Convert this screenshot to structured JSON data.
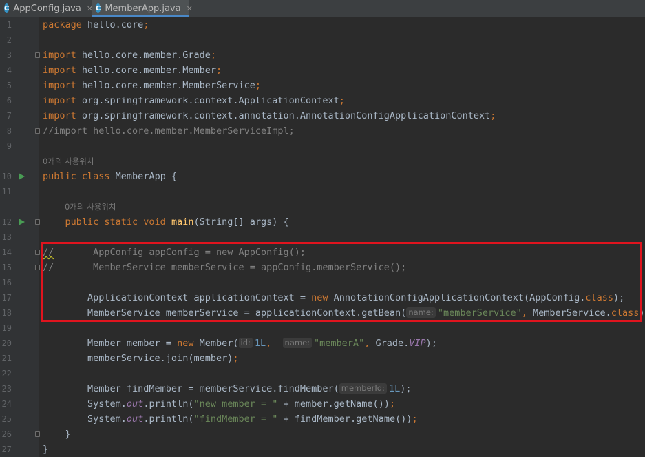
{
  "tabs": [
    {
      "icon": "C",
      "label": "AppConfig.java",
      "close": "✕"
    },
    {
      "icon": "C",
      "label": "MemberApp.java",
      "close": "✕"
    }
  ],
  "lines": [
    {
      "n": "1",
      "segs": [
        [
          "kw",
          "package "
        ],
        [
          "",
          "hello.core"
        ],
        [
          "kw",
          ";"
        ]
      ]
    },
    {
      "n": "2",
      "segs": []
    },
    {
      "n": "3",
      "segs": [
        [
          "kw",
          "import "
        ],
        [
          "",
          "hello.core.member.Grade"
        ],
        [
          "kw",
          ";"
        ]
      ]
    },
    {
      "n": "4",
      "segs": [
        [
          "kw",
          "import "
        ],
        [
          "",
          "hello.core.member.Member"
        ],
        [
          "kw",
          ";"
        ]
      ]
    },
    {
      "n": "5",
      "segs": [
        [
          "kw",
          "import "
        ],
        [
          "",
          "hello.core.member.MemberService"
        ],
        [
          "kw",
          ";"
        ]
      ]
    },
    {
      "n": "6",
      "segs": [
        [
          "kw",
          "import "
        ],
        [
          "",
          "org.springframework.context.ApplicationContext"
        ],
        [
          "kw",
          ";"
        ]
      ]
    },
    {
      "n": "7",
      "segs": [
        [
          "kw",
          "import "
        ],
        [
          "",
          "org.springframework.context.annotation.AnnotationConfigApplicationContext"
        ],
        [
          "kw",
          ";"
        ]
      ]
    },
    {
      "n": "8",
      "segs": [
        [
          "cm",
          "//import hello.core.member.MemberServiceImpl;"
        ]
      ]
    },
    {
      "n": "9",
      "segs": []
    },
    {
      "hint": "0개의 사용위치",
      "indent": 0
    },
    {
      "n": "10",
      "segs": [
        [
          "kw",
          "public class "
        ],
        [
          "",
          "MemberApp {"
        ]
      ]
    },
    {
      "n": "11",
      "segs": []
    },
    {
      "hint": "0개의 사용위치",
      "indent": 4
    },
    {
      "n": "12",
      "segs": [
        [
          "",
          "    "
        ],
        [
          "kw",
          "public static void "
        ],
        [
          "fn",
          "main"
        ],
        [
          "",
          "(String[] args) {"
        ]
      ]
    },
    {
      "n": "13",
      "segs": []
    },
    {
      "n": "14",
      "segs": [
        [
          "cmsq",
          "//"
        ],
        [
          "cm",
          "       AppConfig appConfig = new AppConfig();"
        ]
      ]
    },
    {
      "n": "15",
      "segs": [
        [
          "cm",
          "//       MemberService memberService = appConfig.memberService();"
        ]
      ]
    },
    {
      "n": "16",
      "segs": []
    },
    {
      "n": "17",
      "segs": [
        [
          "",
          "        ApplicationContext applicationContext = "
        ],
        [
          "kw",
          "new "
        ],
        [
          "",
          "AnnotationConfigApplicationContext(AppConfig."
        ],
        [
          "kw",
          "class"
        ],
        [
          "",
          "); "
        ]
      ]
    },
    {
      "n": "18",
      "segs": [
        [
          "",
          "        MemberService memberService = applicationContext.getBean("
        ],
        [
          "ph",
          "name:"
        ],
        [
          "st",
          "\"memberService\""
        ],
        [
          "kw",
          ", "
        ],
        [
          "",
          "MemberService."
        ],
        [
          "kw",
          "class"
        ],
        [
          "",
          "); "
        ]
      ]
    },
    {
      "n": "19",
      "segs": []
    },
    {
      "n": "20",
      "segs": [
        [
          "",
          "        Member member = "
        ],
        [
          "kw",
          "new "
        ],
        [
          "",
          "Member("
        ],
        [
          "ph",
          "id:"
        ],
        [
          "nm",
          "1L"
        ],
        [
          "kw",
          ",  "
        ],
        [
          "ph",
          "name:"
        ],
        [
          "st",
          "\"memberA\""
        ],
        [
          "kw",
          ", "
        ],
        [
          "",
          "Grade."
        ],
        [
          "it",
          "VIP"
        ],
        [
          "",
          "); "
        ]
      ]
    },
    {
      "n": "21",
      "segs": [
        [
          "",
          "        memberService.join(member)"
        ],
        [
          "kw",
          ";"
        ]
      ]
    },
    {
      "n": "22",
      "segs": []
    },
    {
      "n": "23",
      "segs": [
        [
          "",
          "        Member findMember = memberService.findMember("
        ],
        [
          "ph",
          "memberId:"
        ],
        [
          "nm",
          "1L"
        ],
        [
          "",
          "); "
        ]
      ]
    },
    {
      "n": "24",
      "segs": [
        [
          "",
          "        System."
        ],
        [
          "it",
          "out"
        ],
        [
          "",
          ".println("
        ],
        [
          "st",
          "\"new member = \""
        ],
        [
          "",
          " + member.getName())"
        ],
        [
          "kw",
          ";"
        ]
      ]
    },
    {
      "n": "25",
      "segs": [
        [
          "",
          "        System."
        ],
        [
          "it",
          "out"
        ],
        [
          "",
          ".println("
        ],
        [
          "st",
          "\"findMember = \""
        ],
        [
          "",
          " + findMember.getName())"
        ],
        [
          "kw",
          ";"
        ]
      ]
    },
    {
      "n": "26",
      "segs": [
        [
          "",
          "    }"
        ]
      ]
    },
    {
      "n": "27",
      "segs": [
        [
          "",
          "}"
        ]
      ]
    }
  ],
  "run_rows": [
    "10",
    "12"
  ],
  "fold_rows": [
    "3",
    "8",
    "12",
    "14",
    "15",
    "26"
  ],
  "colors": {
    "background": "#2b2b2b",
    "keyword": "#cc7832",
    "string": "#6a8759",
    "comment": "#808080",
    "highlight": "#e0141e"
  }
}
